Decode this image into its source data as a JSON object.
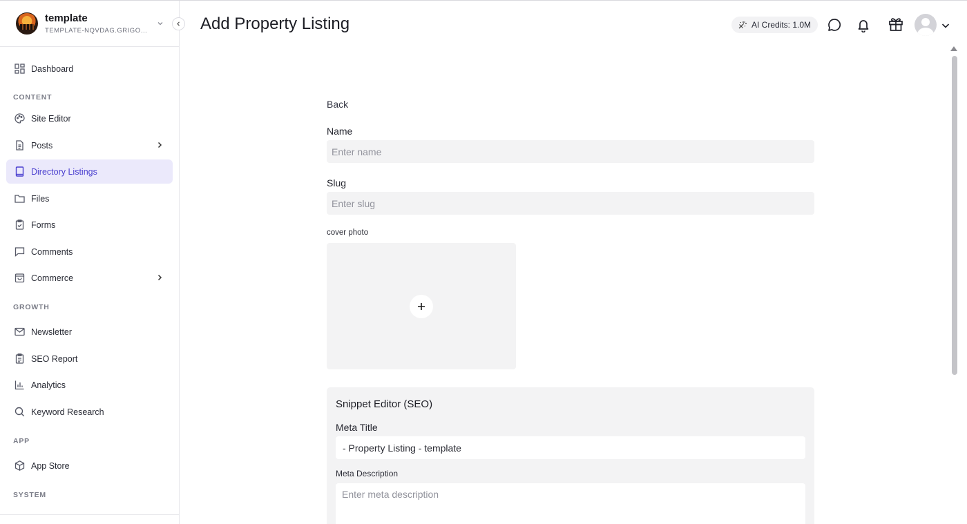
{
  "site": {
    "name": "template",
    "subdomain": "TEMPLATE-NQVDAG.GRIGOR..."
  },
  "sidebar": {
    "dashboard": "Dashboard",
    "sections": {
      "content": "CONTENT",
      "growth": "GROWTH",
      "app": "APP",
      "system": "SYSTEM"
    },
    "items": {
      "site_editor": "Site Editor",
      "posts": "Posts",
      "directory_listings": "Directory Listings",
      "files": "Files",
      "forms": "Forms",
      "comments": "Comments",
      "commerce": "Commerce",
      "newsletter": "Newsletter",
      "seo_report": "SEO Report",
      "analytics": "Analytics",
      "keyword_research": "Keyword Research",
      "app_store": "App Store"
    },
    "active_item": "Directory Listings"
  },
  "header": {
    "title": "Add Property Listing",
    "ai_credits": "AI Credits: 1.0M"
  },
  "form": {
    "back": "Back",
    "name_label": "Name",
    "name_placeholder": "Enter name",
    "slug_label": "Slug",
    "slug_placeholder": "Enter slug",
    "cover_label": "cover photo",
    "add_icon": "plus-icon"
  },
  "seo": {
    "title": "Snippet Editor (SEO)",
    "meta_title_label": "Meta Title",
    "meta_title_value": "- Property Listing - template",
    "meta_description_label": "Meta Description",
    "meta_description_placeholder": "Enter meta description"
  },
  "colors": {
    "accent": "#4a3fcf",
    "active_bg": "#ebe9fb",
    "input_bg": "#f3f3f4"
  }
}
